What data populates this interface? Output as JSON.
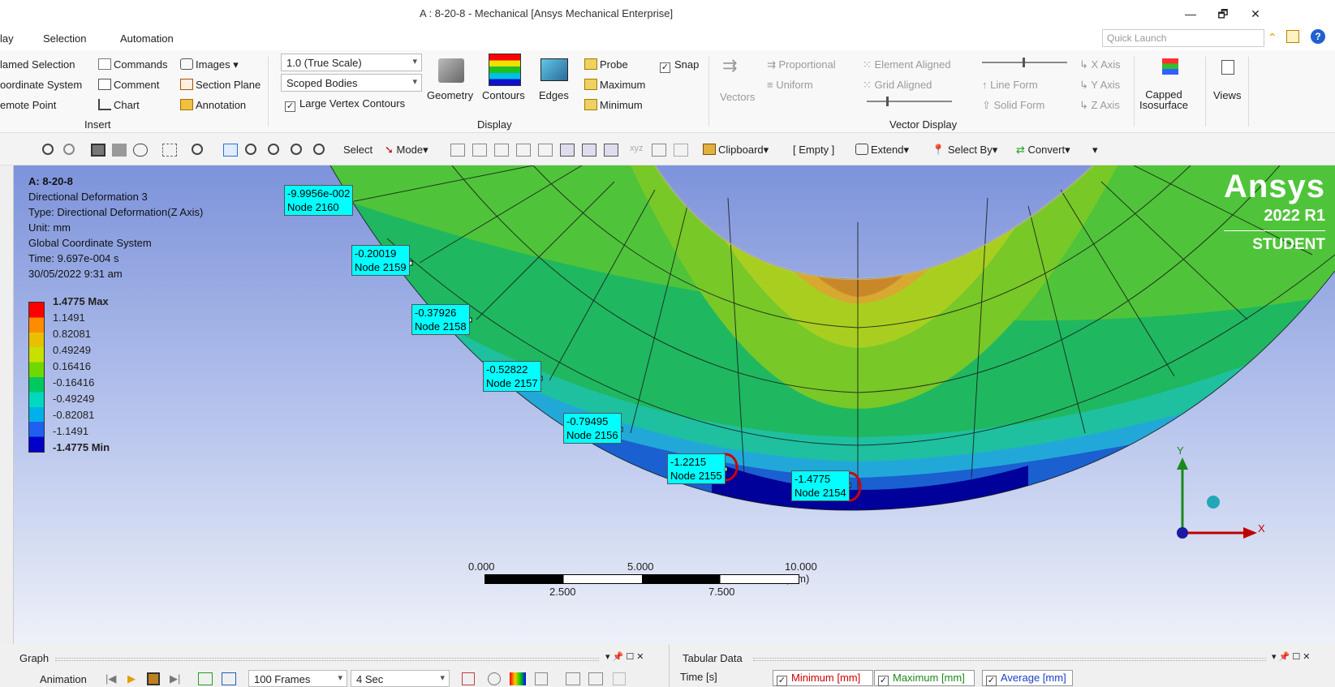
{
  "window": {
    "title": "A : 8-20-8 - Mechanical [Ansys Mechanical Enterprise]",
    "minimize": "—",
    "restore": "🗗",
    "close": "✕"
  },
  "menubar": {
    "tabs": [
      "lay",
      "Selection",
      "Automation"
    ],
    "quick_launch_placeholder": "Quick Launch"
  },
  "ribbon": {
    "insert": {
      "items": [
        "lamed Selection",
        "oordinate System",
        "emote Point",
        "Commands",
        "Comment",
        "Chart",
        "Images",
        "Section Plane",
        "Annotation"
      ],
      "group_label": "Insert"
    },
    "display": {
      "scale_value": "1.0 (True Scale)",
      "scope_value": "Scoped Bodies",
      "large_vertex_label": "Large Vertex Contours",
      "geometry_label": "Geometry",
      "contours_label": "Contours",
      "edges_label": "Edges",
      "probe_label": "Probe",
      "maximum_label": "Maximum",
      "minimum_label": "Minimum",
      "snap_label": "Snap",
      "group_label": "Display"
    },
    "vector_display": {
      "vectors_label": "Vectors",
      "proportional_label": "Proportional",
      "uniform_label": "Uniform",
      "element_aligned_label": "Element Aligned",
      "grid_aligned_label": "Grid Aligned",
      "line_form_label": "Line Form",
      "solid_form_label": "Solid Form",
      "x_axis_label": "X Axis",
      "y_axis_label": "Y Axis",
      "z_axis_label": "Z Axis",
      "group_label": "Vector Display"
    },
    "capped_isosurface_label": "Capped\nIsosurface",
    "views_label": "Views"
  },
  "toolbar": {
    "select_label": "Select",
    "mode_label": "Mode",
    "clipboard_label": "Clipboard",
    "empty_label": "[ Empty ]",
    "extend_label": "Extend",
    "select_by_label": "Select By",
    "convert_label": "Convert"
  },
  "result": {
    "name": "A: 8-20-8",
    "lines": [
      "Directional Deformation 3",
      "Type: Directional Deformation(Z Axis)",
      "Unit: mm",
      "Global Coordinate System",
      "Time: 9.697e-004 s",
      "30/05/2022 9:31 am"
    ]
  },
  "legend": {
    "labels": [
      "1.4775 Max",
      "1.1491",
      "0.82081",
      "0.49249",
      "0.16416",
      "-0.16416",
      "-0.49249",
      "-0.82081",
      "-1.1491",
      "-1.4775 Min"
    ],
    "colors": [
      "#ff0000",
      "#ff8c00",
      "#e8c000",
      "#c8e000",
      "#6fd800",
      "#00c860",
      "#00d8c0",
      "#00b0e8",
      "#2060f0",
      "#0000c8"
    ]
  },
  "probes": [
    {
      "value": "-9.9956e-002",
      "node": "Node 2160"
    },
    {
      "value": "-0.20019",
      "node": "Node 2159"
    },
    {
      "value": "-0.37926",
      "node": "Node 2158"
    },
    {
      "value": "-0.52822",
      "node": "Node 2157"
    },
    {
      "value": "-0.79495",
      "node": "Node 2156"
    },
    {
      "value": "-1.2215",
      "node": "Node 2155"
    },
    {
      "value": "-1.4775",
      "node": "Node 2154"
    }
  ],
  "branding": {
    "name": "Ansys",
    "version": "2022 R1",
    "edition": "STUDENT"
  },
  "triad": {
    "x_label": "X",
    "y_label": "Y"
  },
  "scale_bar": {
    "top_labels": [
      "0.000",
      "5.000",
      "10.000 (mm)"
    ],
    "bottom_labels": [
      "2.500",
      "7.500"
    ]
  },
  "bottom": {
    "graph_title": "Graph",
    "tabular_title": "Tabular Data",
    "animation_label": "Animation",
    "frames_value": "100 Frames",
    "duration_value": "4 Sec",
    "columns": [
      "Time [s]",
      "Minimum [mm]",
      "Maximum [mm]",
      "Average [mm]"
    ],
    "column_colors": [
      "#222222",
      "#cc0000",
      "#1a8a1a",
      "#1a3ec8"
    ]
  }
}
